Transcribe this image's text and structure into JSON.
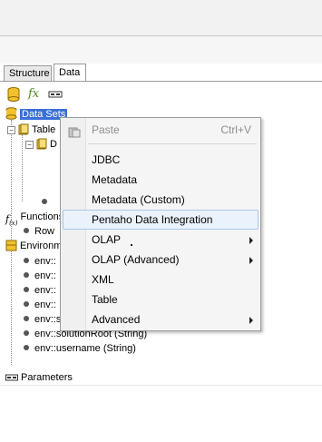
{
  "tabs": {
    "structure": "Structure",
    "data": "Data"
  },
  "toolbar": {
    "icons": [
      "database-icon",
      "function-icon",
      "parameters-icon"
    ],
    "function_glyph": "fx"
  },
  "tree": {
    "datasets": "Data Sets",
    "table": "Table",
    "d_item": "D",
    "functions": "Functions",
    "row": "Row",
    "environment": "Environm",
    "env_items": [
      "env::",
      "env::",
      "env::",
      "env::",
      "env::serverBaseURL (String)",
      "env::solutionRoot (String)",
      "env::username (String)"
    ],
    "parameters": "Parameters"
  },
  "context_menu": {
    "paste": "Paste",
    "paste_shortcut": "Ctrl+V",
    "items": [
      "JDBC",
      "Metadata",
      "Metadata (Custom)",
      "Pentaho Data Integration",
      "OLAP",
      "OLAP (Advanced)",
      "XML",
      "Table",
      "Advanced"
    ]
  },
  "colors": {
    "selection": "#3a6fd8",
    "menu_hover_border": "#aac6e8",
    "menu_bg": "#f5f5f5"
  }
}
